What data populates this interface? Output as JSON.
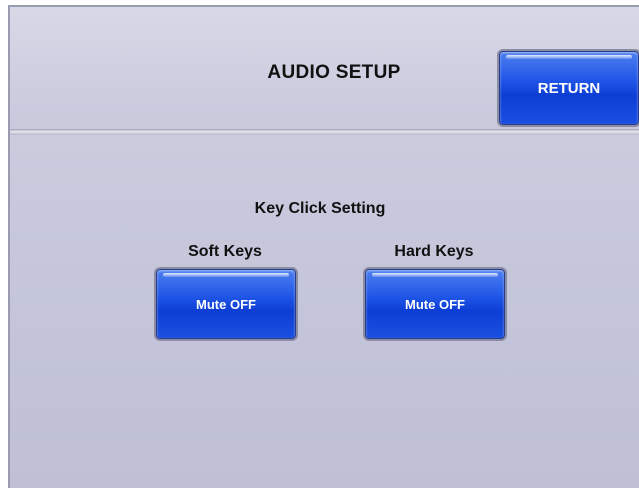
{
  "header": {
    "title": "AUDIO SETUP",
    "return_label": "RETURN"
  },
  "key_click": {
    "section_title": "Key Click Setting",
    "soft_keys": {
      "label": "Soft Keys",
      "button_label": "Mute OFF"
    },
    "hard_keys": {
      "label": "Hard Keys",
      "button_label": "Mute OFF"
    }
  },
  "colors": {
    "panel_background": "#c8c9dc",
    "button_blue": "#1f55e6",
    "button_text": "#ffffff",
    "title_text": "#111111"
  }
}
